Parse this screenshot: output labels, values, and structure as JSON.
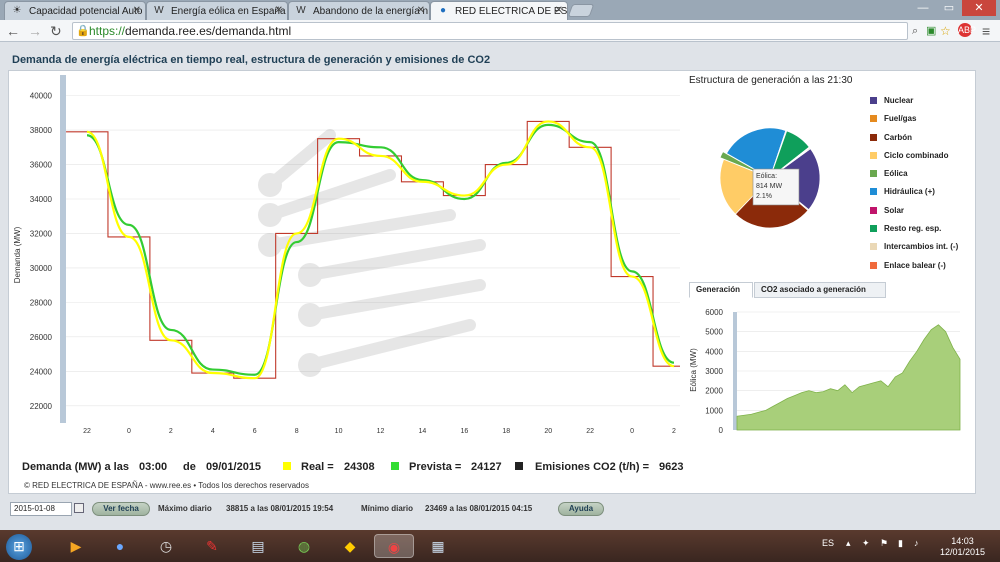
{
  "browser": {
    "tabs": [
      {
        "icon": "sun-icon",
        "label": "Capacidad potencial Auto"
      },
      {
        "icon": "wikipedia-icon",
        "label": "Energía eólica en España"
      },
      {
        "icon": "wikipedia-icon",
        "label": "Abandono de la energía n"
      },
      {
        "icon": "ree-icon",
        "label": "RED ELECTRICA DE ESPAÑ"
      }
    ],
    "url_scheme": "https://",
    "url_rest": "demanda.ree.es/demanda.html"
  },
  "page": {
    "title": "Demanda de energía eléctrica en tiempo real, estructura de generación y emisiones de CO2",
    "structure_title": "Estructura de generación a las 21:30"
  },
  "demand_chart": {
    "ylabel": "Demanda (MW)",
    "yticks": [
      "40000",
      "38000",
      "36000",
      "34000",
      "32000",
      "30000",
      "28000",
      "26000",
      "24000",
      "22000"
    ],
    "xticks": [
      "22",
      "0",
      "2",
      "4",
      "6",
      "8",
      "10",
      "12",
      "14",
      "16",
      "18",
      "20",
      "22",
      "0",
      "2"
    ]
  },
  "chart_data": [
    {
      "type": "line",
      "ylabel": "Demanda (MW)",
      "ylim": [
        21000,
        40500
      ],
      "x": [
        "22",
        "0",
        "2",
        "4",
        "6",
        "8",
        "10",
        "12",
        "14",
        "16",
        "18",
        "20",
        "22",
        "0",
        "2"
      ],
      "series": [
        {
          "name": "Real",
          "color": "#ffff00",
          "values": [
            37900,
            31800,
            25800,
            23900,
            23600,
            32000,
            37500,
            36500,
            35000,
            34200,
            36000,
            38500,
            37000,
            29500,
            24300
          ]
        },
        {
          "name": "Prevista",
          "color": "#33cc33",
          "values": [
            37700,
            32500,
            26400,
            24100,
            23800,
            31500,
            37300,
            37000,
            35100,
            34000,
            36100,
            38300,
            37300,
            29800,
            24500
          ]
        }
      ]
    },
    {
      "type": "pie",
      "title": "Estructura de generación a las 21:30",
      "slices": [
        {
          "name": "Nuclear",
          "value": 21,
          "color": "#4b3f8c"
        },
        {
          "name": "Fuel/gas",
          "value": 0.3,
          "color": "#e58a1f"
        },
        {
          "name": "Carbón",
          "value": 26,
          "color": "#8b2a0a"
        },
        {
          "name": "Ciclo combinado",
          "value": 19,
          "color": "#ffcc66"
        },
        {
          "name": "Eólica",
          "value": 2.1,
          "color": "#6aa84f"
        },
        {
          "name": "Hidráulica (+)",
          "value": 22,
          "color": "#1f8dd6"
        },
        {
          "name": "Solar",
          "value": 0.3,
          "color": "#c0146b"
        },
        {
          "name": "Resto reg. esp.",
          "value": 9,
          "color": "#0f9f5b"
        },
        {
          "name": "Intercambios int. (-)",
          "value": 0.3,
          "color": "#ead8b6"
        },
        {
          "name": "Enlace balear (-)",
          "value": 0.3,
          "color": "#f06a3c"
        }
      ]
    },
    {
      "type": "area",
      "ylabel": "Eólica (MW)",
      "ylim": [
        0,
        6000
      ],
      "yticks": [
        "6000",
        "5000",
        "4000",
        "3000",
        "2000",
        "1000",
        "0"
      ],
      "values": [
        700,
        750,
        800,
        900,
        1000,
        1200,
        1400,
        1600,
        1750,
        1900,
        2000,
        1900,
        1950,
        2100,
        2000,
        2300,
        1900,
        2200,
        2300,
        2400,
        2500,
        2200,
        2700,
        2900,
        3500,
        4000,
        4600,
        5100,
        5350,
        5000,
        4200,
        3600
      ],
      "color": "#a8cf7a"
    }
  ],
  "tooltip": {
    "line1": "Eólica:",
    "line2": " 814 MW",
    "line3": "2.1%"
  },
  "tabs_gen": {
    "generacion": "Generación",
    "co2": "CO2 asociado a generación"
  },
  "summary": {
    "demanda_label": "Demanda (MW) a las",
    "hora": "03:00",
    "de": "de",
    "fecha": "09/01/2015",
    "real_label": "Real =",
    "real_value": "24308",
    "prevista_label": "Prevista =",
    "prevista_value": "24127",
    "emisiones_label": "Emisiones CO2 (t/h) =",
    "emisiones_value": "9623"
  },
  "copyright": "© RED ELECTRICA DE ESPAÑA - www.ree.es • Todos los derechos reservados",
  "footer": {
    "date_value": "2015-01-08",
    "ver_fecha": "Ver fecha",
    "max_label": "Máximo diario",
    "max_value": "38815 a las 08/01/2015 19:54",
    "min_label": "Mínimo diario",
    "min_value": "23469 a las 08/01/2015 04:15",
    "ayuda": "Ayuda"
  },
  "taskbar": {
    "lang": "ES",
    "time": "14:03",
    "date": "12/01/2015"
  }
}
